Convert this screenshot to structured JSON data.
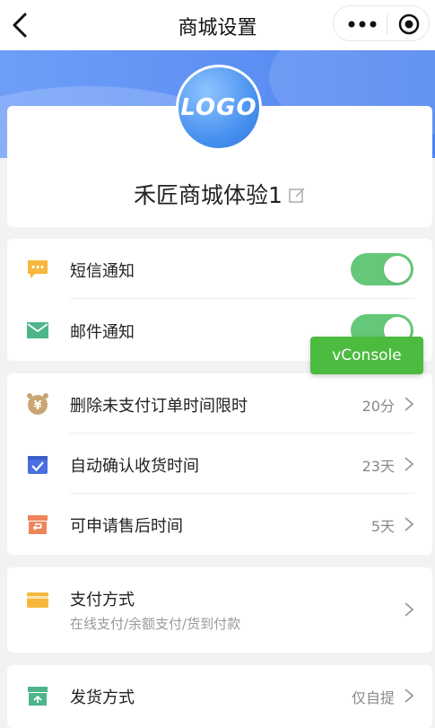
{
  "nav": {
    "title": "商城设置"
  },
  "logo": {
    "text": "LOGO"
  },
  "shop": {
    "name": "禾匠商城体验1"
  },
  "notifications": [
    {
      "label": "短信通知",
      "enabled": true,
      "icon": "message-icon",
      "color": "#f5b83d"
    },
    {
      "label": "邮件通知",
      "enabled": true,
      "icon": "mail-icon",
      "color": "#4cb58a"
    }
  ],
  "timers": [
    {
      "label": "删除未支付订单时间限时",
      "value": "20分",
      "icon": "alarm-clock-icon",
      "color": "#c9a574"
    },
    {
      "label": "自动确认收货时间",
      "value": "23天",
      "icon": "check-box-icon",
      "color": "#4a6fe0"
    },
    {
      "label": "可申请售后时间",
      "value": "5天",
      "icon": "return-box-icon",
      "color": "#f0845a"
    }
  ],
  "payment": {
    "label": "支付方式",
    "sublabel": "在线支付/余额支付/货到付款",
    "icon": "wallet-icon",
    "color": "#f5b83d"
  },
  "delivery": {
    "label": "发货方式",
    "value": "仅自提",
    "icon": "delivery-box-icon",
    "color": "#4cb58a"
  },
  "vconsole": {
    "label": "vConsole"
  },
  "colors": {
    "toggle_on": "#65c878",
    "banner": "#5a8ff2",
    "vconsole": "#4cbb3f"
  }
}
